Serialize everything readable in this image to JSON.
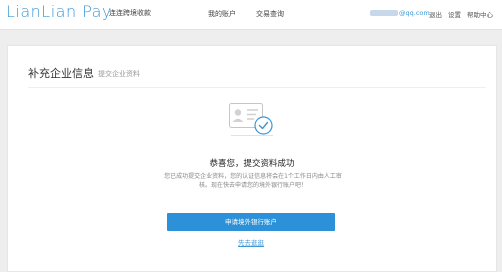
{
  "header": {
    "logo_text": "LianLian Pay",
    "tagline": "连连跨境收款",
    "nav": {
      "my_account": "我的账户",
      "transaction_query": "交易查询"
    },
    "user_email_visible": "@qq.com",
    "links": {
      "logout": "退出",
      "settings": "设置",
      "help_center": "帮助中心"
    }
  },
  "page": {
    "title": "补充企业信息",
    "subtitle": "提交企业资料"
  },
  "result": {
    "title": "恭喜您，提交资料成功",
    "description": "您已成功提交企业资料，您的认证信息将会在1个工作日内由人工审核。现在快去申请您的境外银行账户吧！",
    "primary_button": "申请境外银行账户",
    "secondary_link": "先去逛逛"
  },
  "colors": {
    "brand": "#3d97d4",
    "primary_button": "#2c91d8",
    "page_background": "#eeeeee"
  }
}
